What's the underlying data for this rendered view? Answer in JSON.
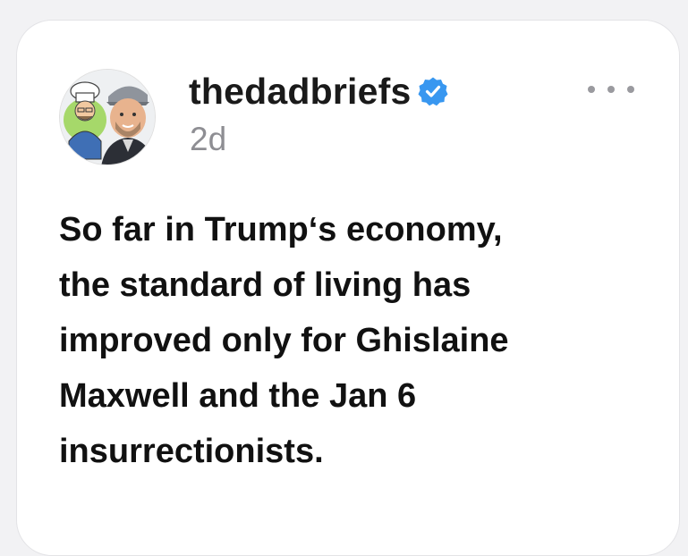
{
  "post": {
    "username": "thedadbriefs",
    "verified": true,
    "timestamp": "2d",
    "lines": [
      "So far in Trump‘s economy,",
      "the standard of living has",
      "improved only for Ghislaine",
      "Maxwell and the Jan 6",
      "insurrectionists."
    ]
  },
  "icons": {
    "verified": "verified-badge-icon",
    "more": "more-options-icon"
  },
  "colors": {
    "verified_badge": "#3897f0",
    "timestamp": "#8e8e93",
    "text": "#111111"
  }
}
